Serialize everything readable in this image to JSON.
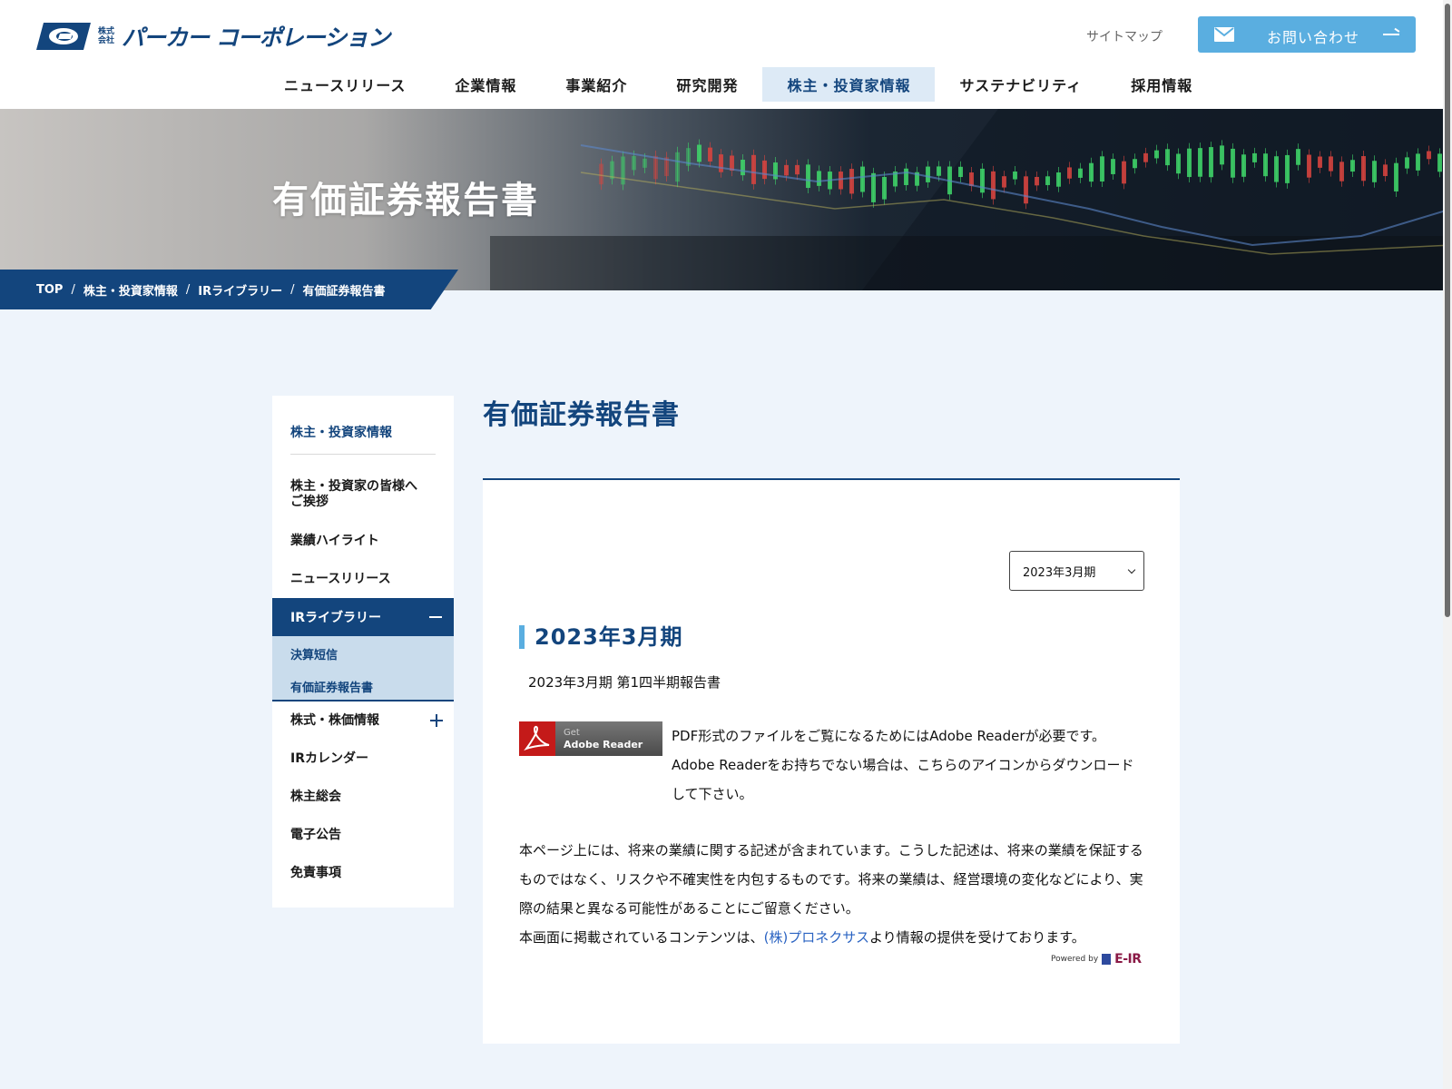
{
  "header": {
    "logo_kabu_top": "株式",
    "logo_kabu_bottom": "会社",
    "logo_text": "パーカー コーポレーション",
    "sitemap_label": "サイトマップ",
    "contact_label": "お問い合わせ"
  },
  "nav": {
    "items": [
      {
        "label": "ニュースリリース"
      },
      {
        "label": "企業情報"
      },
      {
        "label": "事業紹介"
      },
      {
        "label": "研究開発"
      },
      {
        "label": "株主・投資家情報"
      },
      {
        "label": "サステナビリティ"
      },
      {
        "label": "採用情報"
      }
    ],
    "active_index": 4
  },
  "hero": {
    "title": "有価証券報告書"
  },
  "breadcrumb": {
    "items": [
      "TOP",
      "株主・投資家情報",
      "IRライブラリー",
      "有価証券報告書"
    ],
    "separator": "/"
  },
  "sidebar": {
    "heading": "株主・投資家情報",
    "items": [
      {
        "label": "株主・投資家の皆様へ\nご挨拶"
      },
      {
        "label": "業績ハイライト"
      },
      {
        "label": "ニュースリリース"
      },
      {
        "label": "IRライブラリー"
      },
      {
        "label": "株式・株価情報"
      },
      {
        "label": "IRカレンダー"
      },
      {
        "label": "株主総会"
      },
      {
        "label": "電子公告"
      },
      {
        "label": "免責事項"
      }
    ],
    "sub_items": [
      {
        "label": "決算短信"
      },
      {
        "label": "有価証券報告書"
      }
    ]
  },
  "main": {
    "page_title": "有価証券報告書",
    "select_value": "2023年3月期",
    "period_heading": "2023年3月期",
    "report_link": "2023年3月期 第1四半期報告書",
    "adobe_get": "Get",
    "adobe_reader": "Adobe Reader",
    "pdf_note": "PDF形式のファイルをご覧になるためにはAdobe Readerが必要です。Adobe Readerをお持ちでない場合は、こちらのアイコンからダウンロードして下さい。",
    "disclaimer": "本ページ上には、将来の業績に関する記述が含まれています。こうした記述は、将来の業績を保証するものではなく、リスクや不確実性を内包するものです。将来の業績は、経営環境の変化などにより、実際の結果と異なる可能性があることにご留意ください。",
    "provided_prefix": "本画面に掲載されているコンテンツは、",
    "provided_link": "(株)プロネクサス",
    "provided_suffix": "より情報の提供を受けております。",
    "powered_by": "Powered by",
    "eir": "E-IR"
  },
  "colors": {
    "brand_navy": "#13457d",
    "accent_blue": "#5aaee0",
    "link_blue": "#2a63c2",
    "page_bg": "#eef4fb"
  }
}
